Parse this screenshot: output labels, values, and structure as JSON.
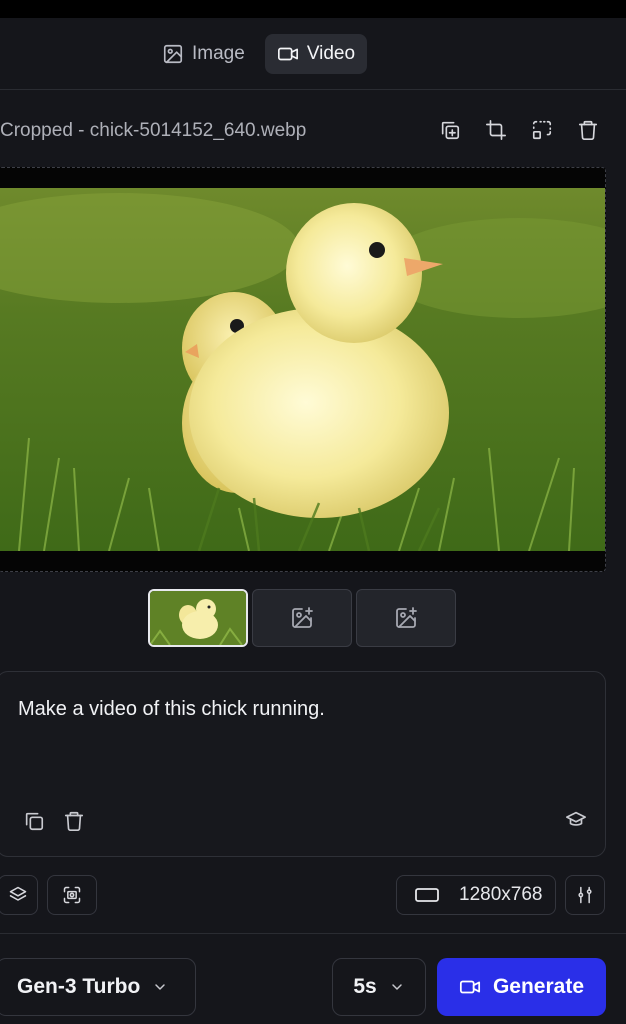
{
  "modes": {
    "image_label": "Image",
    "video_label": "Video",
    "active": "Video"
  },
  "file": {
    "name": "Cropped - chick-5014152_640.webp"
  },
  "file_tools": [
    "duplicate-icon",
    "crop-icon",
    "focus-select-icon",
    "trash-icon"
  ],
  "canvas": {
    "image_alt": "Two yellow chicks standing in green grass"
  },
  "thumbnails": [
    {
      "state": "selected",
      "icon": "chick-thumbnail"
    },
    {
      "state": "empty",
      "icon": "add-image-icon"
    },
    {
      "state": "empty",
      "icon": "add-image-icon"
    }
  ],
  "prompt": {
    "text": "Make a video of this chick running."
  },
  "settings": {
    "resolution": "1280x768"
  },
  "bottom": {
    "model": "Gen-3 Turbo",
    "duration": "5s",
    "generate_label": "Generate"
  },
  "colors": {
    "accent": "#2a2fe8",
    "background": "#15161b",
    "panel": "#17181d"
  }
}
